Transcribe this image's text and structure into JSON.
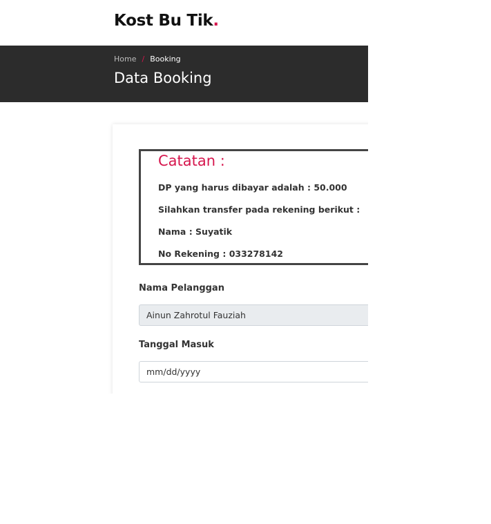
{
  "brand": {
    "name": "Kost Bu Tik",
    "dot": "."
  },
  "breadcrumb": {
    "home": "Home",
    "separator": "/",
    "current": "Booking"
  },
  "page_title": "Data Booking",
  "note": {
    "title": "Catatan :",
    "lines": [
      "DP yang harus dibayar adalah : 50.000",
      "Silahkan transfer pada rekening berikut :",
      "Nama : Suyatik",
      "No Rekening : 033278142"
    ]
  },
  "form": {
    "customer_label": "Nama Pelanggan",
    "customer_value": "Ainun Zahrotul Fauziah",
    "date_label": "Tanggal Masuk",
    "date_placeholder": "mm/dd/yyyy"
  },
  "colors": {
    "accent": "#d6164d",
    "hero_bg": "#2c2c2c"
  }
}
